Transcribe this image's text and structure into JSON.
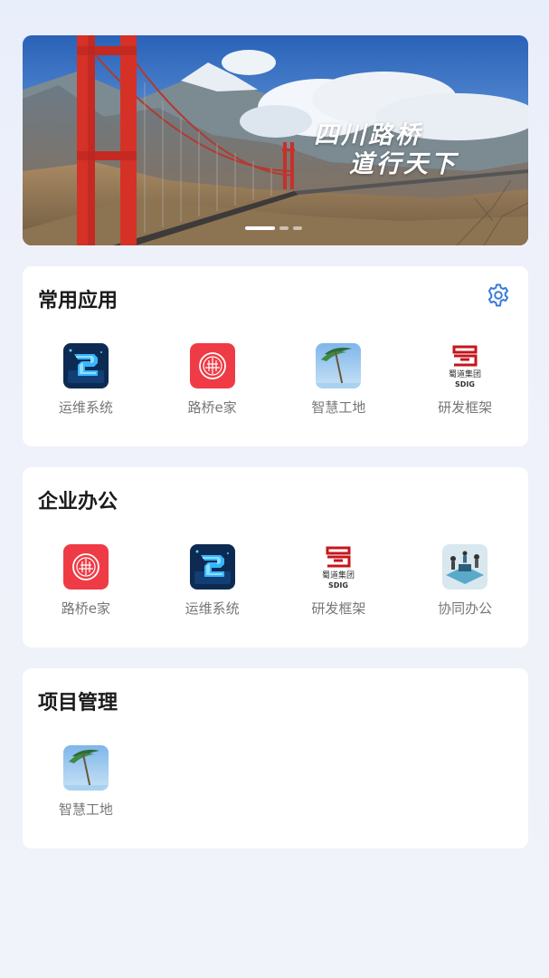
{
  "banner": {
    "slogan_line1": "四川路桥",
    "slogan_line2": "道行天下",
    "slide_count": 3,
    "active_slide": 1
  },
  "sections": [
    {
      "title": "常用应用",
      "has_settings": true,
      "apps": [
        {
          "label": "运维系统",
          "icon": "ops-system-icon"
        },
        {
          "label": "路桥e家",
          "icon": "luqiao-ejia-icon"
        },
        {
          "label": "智慧工地",
          "icon": "smart-site-icon"
        },
        {
          "label": "研发框架",
          "icon": "shudao-group-logo-icon"
        }
      ]
    },
    {
      "title": "企业办公",
      "has_settings": false,
      "apps": [
        {
          "label": "路桥e家",
          "icon": "luqiao-ejia-icon"
        },
        {
          "label": "运维系统",
          "icon": "ops-system-icon"
        },
        {
          "label": "研发框架",
          "icon": "shudao-group-logo-icon"
        },
        {
          "label": "协同办公",
          "icon": "collab-office-icon"
        }
      ]
    },
    {
      "title": "项目管理",
      "has_settings": false,
      "apps": [
        {
          "label": "智慧工地",
          "icon": "smart-site-icon"
        }
      ]
    }
  ],
  "logo_text": {
    "group_name": "蜀道集团",
    "group_abbr": "SDIG"
  },
  "colors": {
    "accent": "#3a7bd5",
    "card_bg": "#ffffff",
    "page_bg": "#eef1fa",
    "ejia_red": "#ef3b45",
    "logo_red": "#c4161c"
  }
}
